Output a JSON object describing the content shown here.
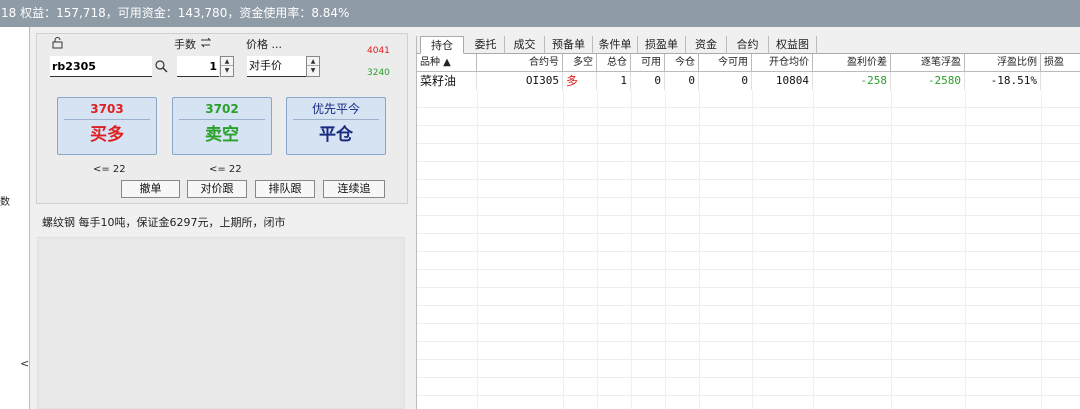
{
  "titlebar": {
    "text": "18 权益：157,718，可用资金：143,780，资金使用率：8.84%"
  },
  "left_panel": {
    "stub_text": "数",
    "collapse_glyph": "<"
  },
  "order": {
    "lock_icon": "lock-icon",
    "qty_label": "手数",
    "qty_icon": "swap-icon",
    "price_label": "价格 ...",
    "contract_code": "rb2305",
    "quantity": "1",
    "price_type": "对手价",
    "limit_up": "4041",
    "limit_down": "3240",
    "buy": {
      "price": "3703",
      "action": "买多",
      "max": "<= 22"
    },
    "sell": {
      "price": "3702",
      "action": "卖空",
      "max": "<= 22"
    },
    "close": {
      "label": "优先平今",
      "action": "平仓"
    },
    "buttons": {
      "cancel": "撤单",
      "chase_opp": "对价跟",
      "chase_queue": "排队跟",
      "chase_cont": "连续追"
    },
    "info": "螺纹钢 每手10吨，保证金6297元，上期所，闭市"
  },
  "tabs": [
    "持仓",
    "委托",
    "成交",
    "预备单",
    "条件单",
    "损盈单",
    "资金",
    "合约",
    "权益图"
  ],
  "positions": {
    "headers": [
      "品种 ▲",
      "合约号",
      "多空",
      "总仓",
      "可用",
      "今仓",
      "今可用",
      "开仓均价",
      "盈利价差",
      "逐笔浮盈",
      "浮盈比例",
      "损盈"
    ],
    "rows": [
      {
        "product": "菜籽油",
        "contract": "OI305",
        "direction": "多",
        "total": "1",
        "avail": "0",
        "today": "0",
        "today_avail": "0",
        "open_avg": "10804",
        "spread": "-258",
        "float_pnl": "-2580",
        "float_ratio": "-18.51%",
        "stop": ""
      }
    ]
  },
  "colors": {
    "buy": "#e02020",
    "sell": "#2aa02a",
    "close": "#1a2a80",
    "titlebar": "#8f9ba6"
  }
}
